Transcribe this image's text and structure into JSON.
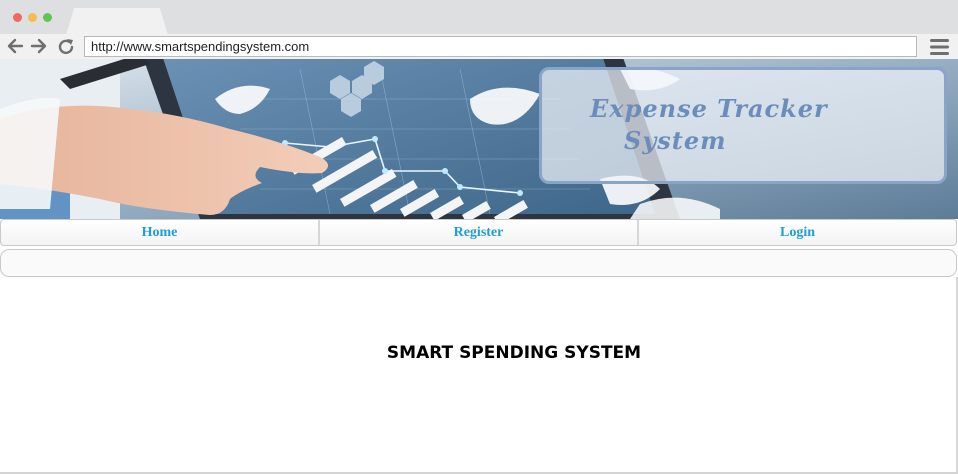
{
  "browser": {
    "url": "http://www.smartspendingsystem.com",
    "icons": [
      "back-arrow-icon",
      "forward-arrow-icon",
      "reload-icon",
      "hamburger-menu-icon"
    ]
  },
  "banner": {
    "title_line1": "Expense   Tracker",
    "title_line2": "System"
  },
  "nav": {
    "home": "Home",
    "register": "Register",
    "login": "Login"
  },
  "main": {
    "heading": "SMART SPENDING SYSTEM"
  },
  "colors": {
    "nav_link": "#1e9ed8",
    "title_text": "#6b8db9",
    "title_border": "#8aa3c8"
  }
}
